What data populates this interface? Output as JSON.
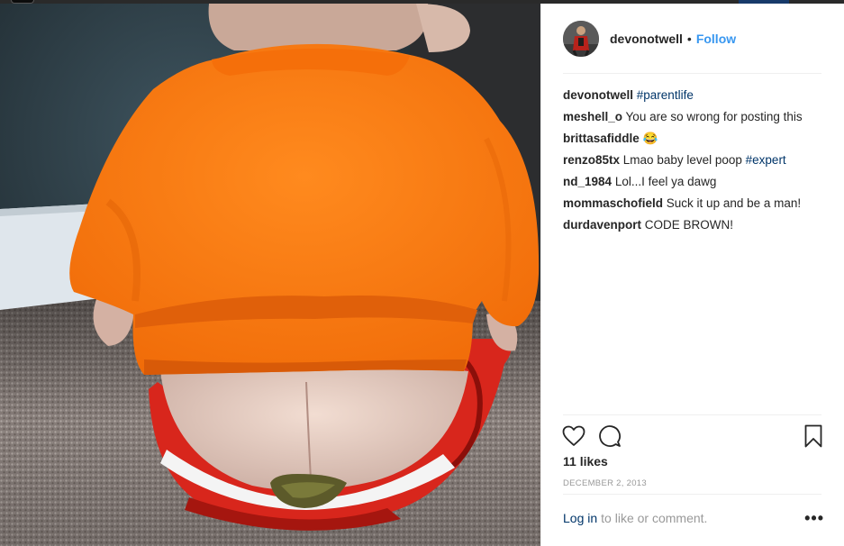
{
  "post": {
    "username": "devonotwell",
    "follow_label": "Follow",
    "separator": "•"
  },
  "comments": [
    {
      "user": "devonotwell",
      "text": "",
      "tag": "#parentlife"
    },
    {
      "user": "meshell_o",
      "text": "You are so wrong for posting this",
      "tag": ""
    },
    {
      "user": "brittasafiddle",
      "text": "😂",
      "tag": ""
    },
    {
      "user": "renzo85tx",
      "text": "Lmao baby level poop",
      "tag": "#expert"
    },
    {
      "user": "nd_1984",
      "text": "Lol...I feel ya dawg",
      "tag": ""
    },
    {
      "user": "mommaschofield",
      "text": "Suck it up and be a man!",
      "tag": ""
    },
    {
      "user": "durdavenport",
      "text": "CODE BROWN!",
      "tag": ""
    }
  ],
  "actions": {
    "like_icon": "heart-outline-icon",
    "comment_icon": "speech-bubble-icon",
    "save_icon": "bookmark-outline-icon"
  },
  "likes": "11 likes",
  "date": "DECEMBER 2, 2013",
  "footer": {
    "login_label": "Log in",
    "rest_text": "to like or comment.",
    "more_label": "•••"
  },
  "colors": {
    "link_blue": "#3897f0",
    "hashtag_navy": "#003569",
    "shirt_orange": "#ff7a10",
    "diaper_red": "#d8261c"
  }
}
